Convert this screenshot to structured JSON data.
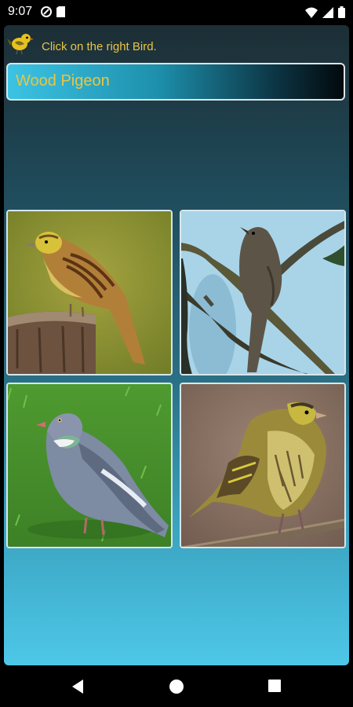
{
  "status_bar": {
    "time": "9:07",
    "icons": [
      "do-not-disturb-icon",
      "sim-card-icon",
      "wifi-icon",
      "signal-icon",
      "battery-icon"
    ]
  },
  "header": {
    "logo_icon": "bird-logo-icon",
    "instruction": "Click on the right Bird."
  },
  "question": {
    "bird_name": "Wood Pigeon"
  },
  "options": [
    {
      "subject": "yellowhammer-on-stump"
    },
    {
      "subject": "nightingale-on-branch"
    },
    {
      "subject": "wood-pigeon-on-grass"
    },
    {
      "subject": "siskin-on-branch"
    }
  ],
  "nav_bar": {
    "icons": [
      "back-icon",
      "home-icon",
      "recents-icon"
    ]
  },
  "colors": {
    "accent_text": "#e8c545",
    "tile_border": "#d7e6ec"
  }
}
